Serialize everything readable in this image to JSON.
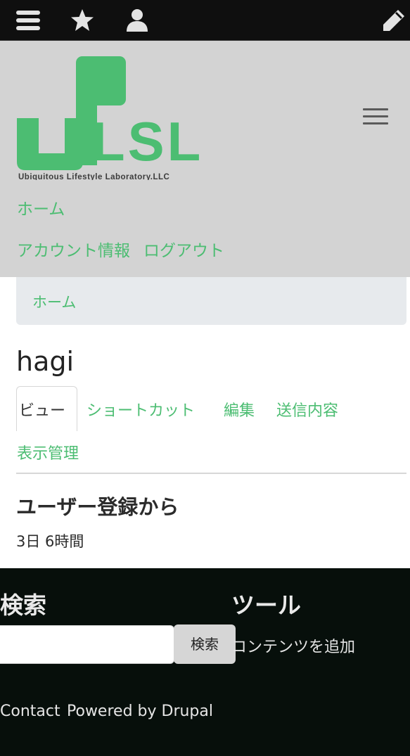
{
  "toolbar": {
    "items": [
      {
        "icon": "menu-icon"
      },
      {
        "icon": "star-icon"
      },
      {
        "icon": "user-icon"
      },
      {
        "icon": "pencil-icon"
      }
    ]
  },
  "header": {
    "logo": {
      "text": "ULSL",
      "subtitle": "Ubiquitous Lifestyle Laboratory.LLC",
      "color": "#4cbd72"
    },
    "nav": {
      "home": "ホーム",
      "account": "アカウント情報",
      "logout": "ログアウト"
    }
  },
  "breadcrumb": {
    "home": "ホーム"
  },
  "page": {
    "title": "hagi",
    "tabs": [
      {
        "label": "ビュー",
        "active": true
      },
      {
        "label": "ショートカット"
      },
      {
        "label": "編集"
      },
      {
        "label": "送信内容"
      },
      {
        "label": "表示管理"
      }
    ],
    "section_heading": "ユーザー登録から",
    "member_for": "3日 6時間"
  },
  "footer": {
    "search": {
      "heading": "検索",
      "button": "検索",
      "value": ""
    },
    "tools": {
      "heading": "ツール",
      "add_content": "コンテンツを追加"
    },
    "links": {
      "contact": "Contact",
      "powered_by": "Powered by Drupal"
    }
  },
  "colors": {
    "accent": "#4cbd72",
    "header_bg": "#d3d3d3",
    "toolbar_bg": "#0f0f0f",
    "footer_bg": "#070f0b"
  }
}
